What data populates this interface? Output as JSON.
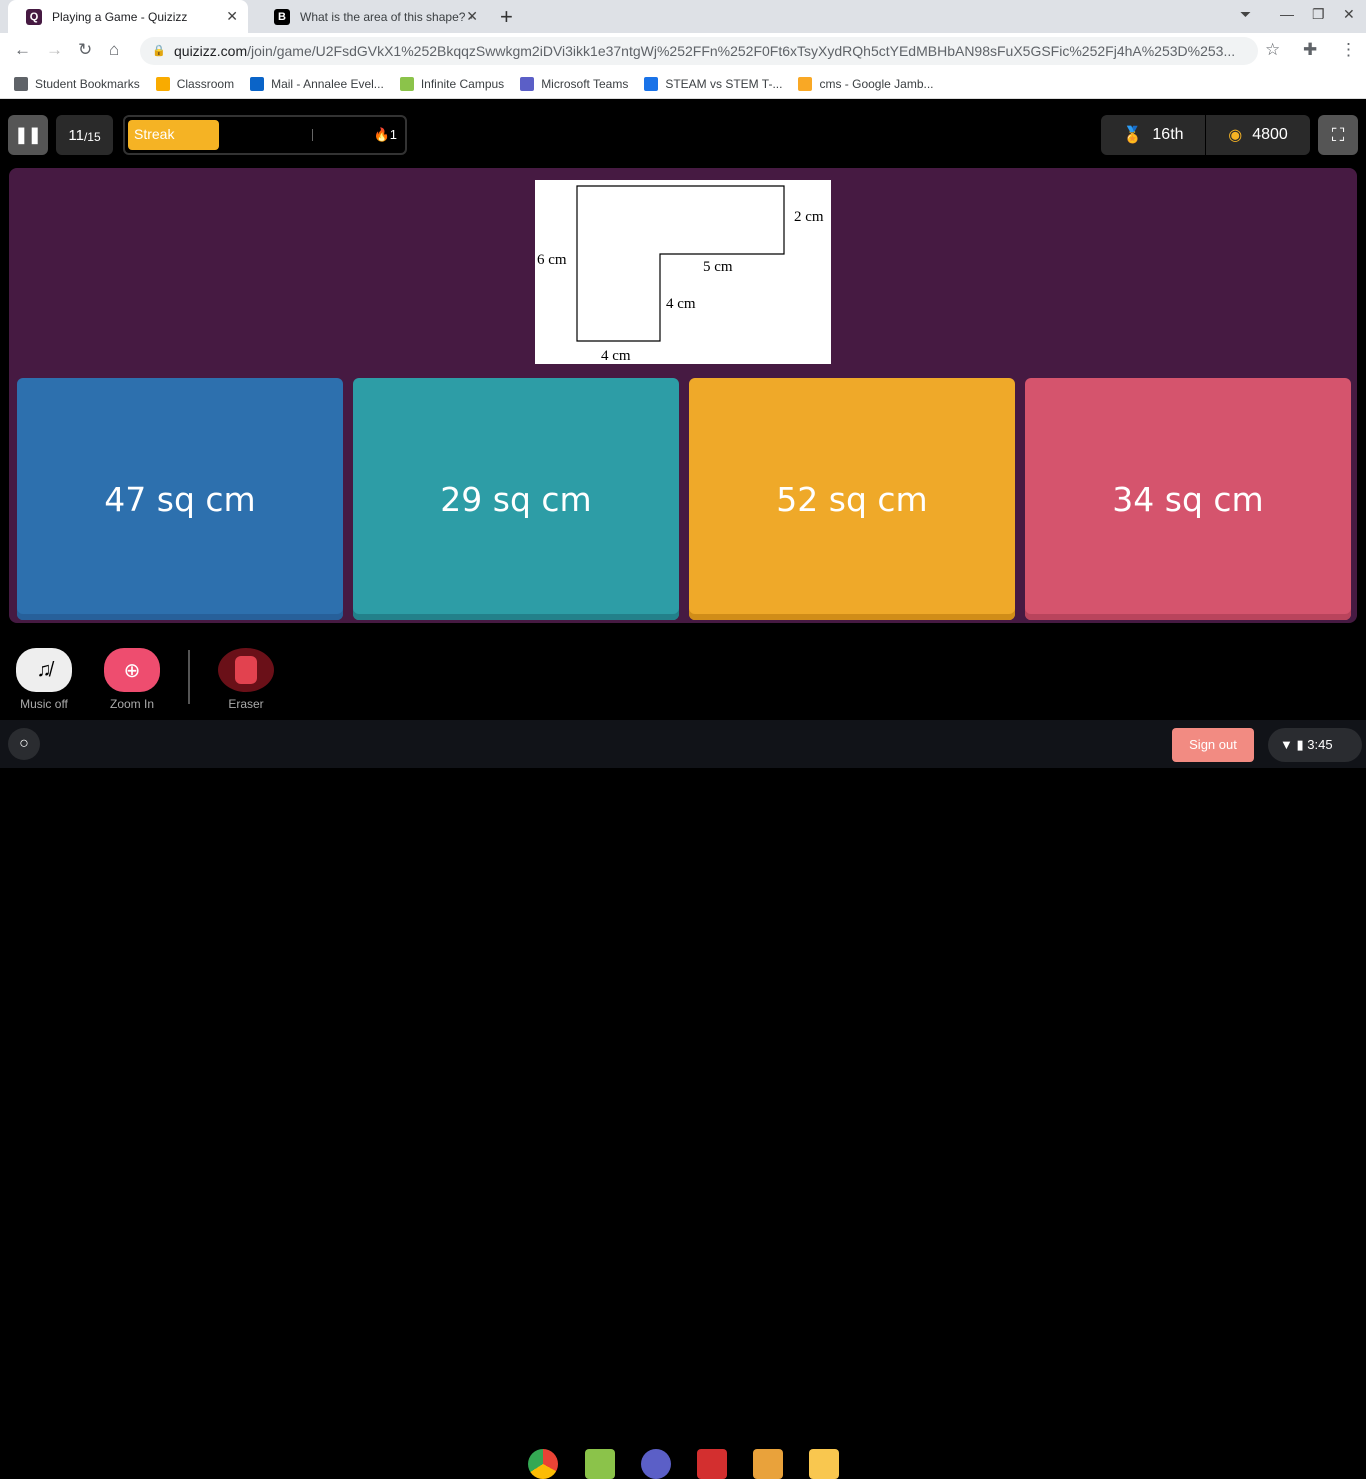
{
  "browser": {
    "tabs": [
      {
        "title": "Playing a Game - Quizizz",
        "icon": "Q"
      },
      {
        "title": "What is the area of this shape? -",
        "icon": "B"
      }
    ],
    "url_host": "quizizz.com",
    "url_path": "/join/game/U2FsdGVkX1%252BkqqzSwwkgm2iDVi3ikk1e37ntgWj%252FFn%252F0Ft6xTsyXydRQh5ctYEdMBHbAN98sFuX5GSFic%252Fj4hA%253D%253...",
    "bookmarks": [
      {
        "label": "Student Bookmarks",
        "color": "#5f6368"
      },
      {
        "label": "Classroom",
        "color": "#f9ab00"
      },
      {
        "label": "Mail - Annalee Evel...",
        "color": "#0a64c8"
      },
      {
        "label": "Infinite Campus",
        "color": "#8bc34a"
      },
      {
        "label": "Microsoft Teams",
        "color": "#5b5fc7"
      },
      {
        "label": "STEAM vs STEM T-...",
        "color": "#1a73e8"
      },
      {
        "label": "cms - Google Jamb...",
        "color": "#f9a825"
      }
    ]
  },
  "game": {
    "question_num": "11",
    "question_total": "/15",
    "streak_label": "Streak",
    "streak_progress": 0.33,
    "streak_count": "1",
    "rank": "16th",
    "score": "4800",
    "diagram_labels": {
      "top_right": "2 cm",
      "left": "6 cm",
      "middle": "5 cm",
      "inner": "4 cm",
      "bottom": "4 cm"
    },
    "options": [
      {
        "text": "47 sq cm",
        "color": "#2d70ae",
        "shade": "#27609a"
      },
      {
        "text": "29 sq cm",
        "color": "#2d9da6",
        "shade": "#23808a"
      },
      {
        "text": "52 sq cm",
        "color": "#efa929",
        "shade": "#d08d18"
      },
      {
        "text": "34 sq cm",
        "color": "#d5546d",
        "shade": "#b9445c"
      }
    ],
    "powerups": [
      {
        "label": "Music off"
      },
      {
        "label": "Zoom In"
      },
      {
        "label": "Eraser"
      }
    ]
  },
  "shelf": {
    "sign_out": "Sign out",
    "time": "3:45"
  }
}
